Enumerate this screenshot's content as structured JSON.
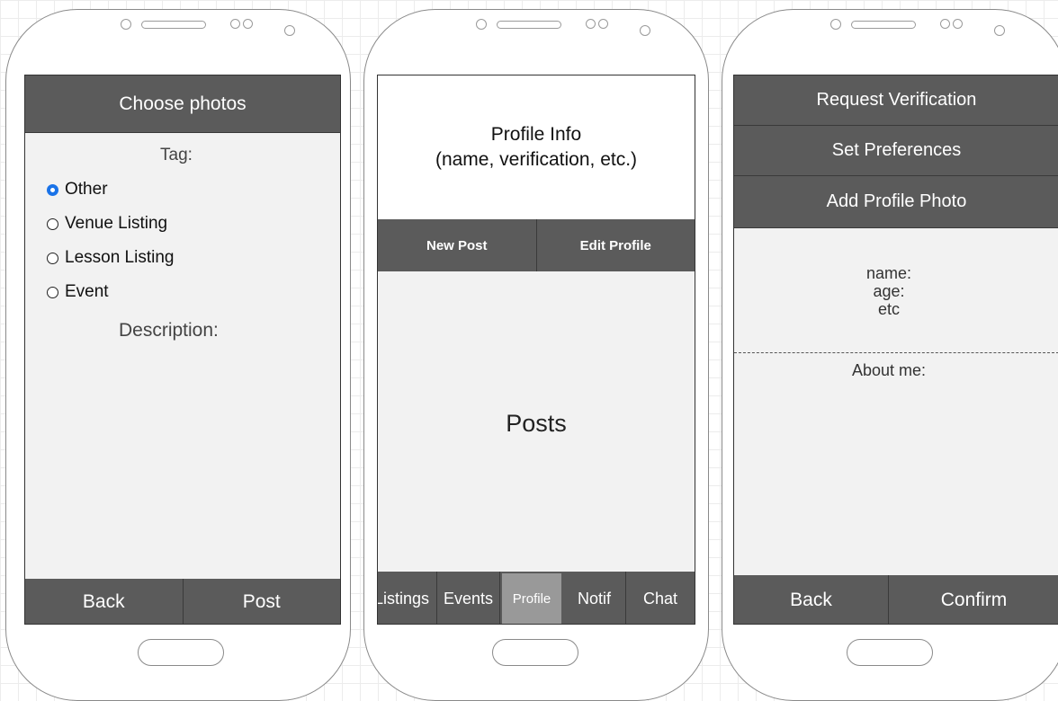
{
  "screen1": {
    "header": "Choose photos",
    "tag_label": "Tag:",
    "options": [
      "Other",
      "Venue Listing",
      "Lesson Listing",
      "Event"
    ],
    "selected_option": "Other",
    "description_label": "Description:",
    "back_label": "Back",
    "post_label": "Post"
  },
  "screen2": {
    "profile_info_line1": "Profile Info",
    "profile_info_line2": "(name, verification, etc.)",
    "new_post_label": "New Post",
    "edit_profile_label": "Edit Profile",
    "posts_label": "Posts",
    "nav": {
      "listings": "Listings",
      "events": "Events",
      "profile": "Profile",
      "notif": "Notif",
      "chat": "Chat"
    },
    "active_tab": "Profile"
  },
  "screen3": {
    "request_verification": "Request Verification",
    "set_preferences": "Set Preferences",
    "add_profile_photo": "Add Profile Photo",
    "name_label": "name:",
    "age_label": "age:",
    "etc_label": "etc",
    "about_label": "About me:",
    "back_label": "Back",
    "confirm_label": "Confirm"
  },
  "colors": {
    "bar": "#5b5b5b",
    "screen": "#f2f2f2",
    "radio_selected": "#1a73e8",
    "active_tab": "#999999"
  }
}
